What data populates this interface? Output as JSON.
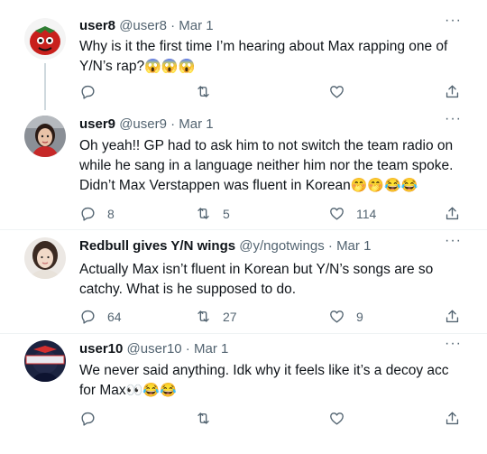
{
  "tweets": [
    {
      "name": "user8",
      "handle": "@user8",
      "date": "Mar 1",
      "more": "···",
      "text": "Why is it the first time I’m hearing about Max rapping one of Y/N’s rap?",
      "emoji": "😱😱😱",
      "replies": "",
      "retweets": "",
      "likes": ""
    },
    {
      "name": "user9",
      "handle": "@user9",
      "date": "Mar 1",
      "more": "···",
      "text": "Oh yeah!! GP had to ask him to not switch the team radio on while he sang in a language neither him nor the team spoke. Didn’t Max Verstappen was fluent in Korean",
      "emoji": "🤭🤭😂😂",
      "replies": "8",
      "retweets": "5",
      "likes": "114"
    },
    {
      "name": "Redbull gives Y/N wings",
      "handle": "@y/ngotwings",
      "date": "Mar 1",
      "more": "···",
      "text": "Actually Max isn’t fluent in Korean but Y/N’s songs are so catchy. What is he supposed to do.",
      "emoji": "",
      "replies": "64",
      "retweets": "27",
      "likes": "9"
    },
    {
      "name": "user10",
      "handle": "@user10",
      "date": "Mar 1",
      "more": "···",
      "text": "We never said anything. Idk why it feels like it’s a decoy acc for Max",
      "emoji": "👀😂😂",
      "replies": "",
      "retweets": "",
      "likes": ""
    }
  ],
  "separator": " · ",
  "icons": [
    "reply-icon",
    "retweet-icon",
    "like-icon",
    "share-icon"
  ],
  "colors": {
    "text": "#0f1419",
    "secondary": "#536471",
    "thread_line": "#cfd9de",
    "background": "#ffffff"
  }
}
